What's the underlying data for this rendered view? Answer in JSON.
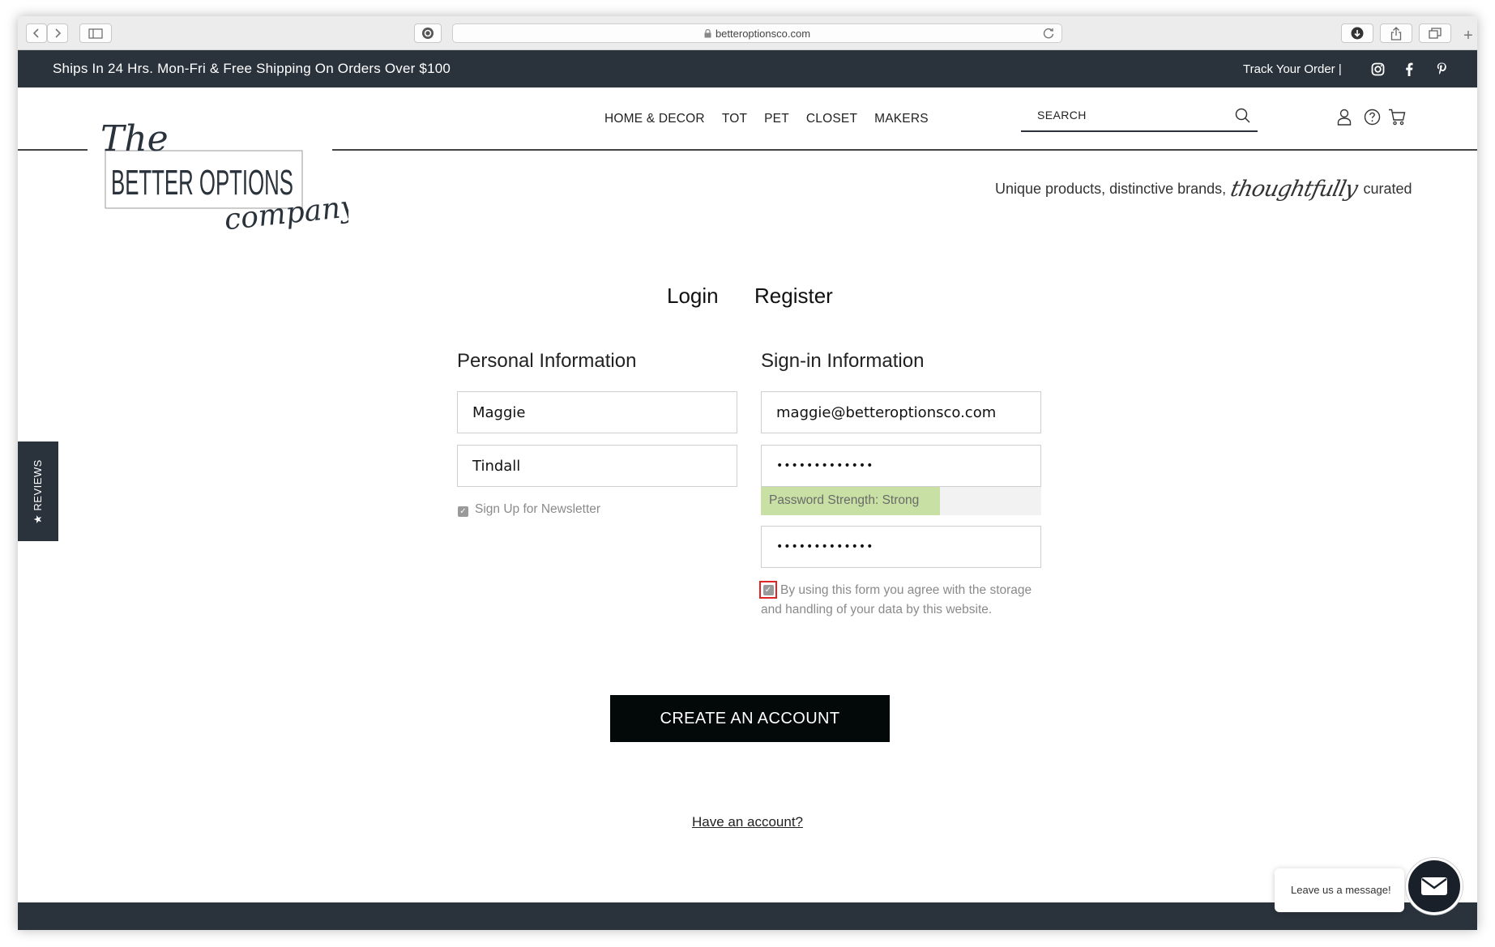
{
  "browser": {
    "url": "betteroptionsco.com"
  },
  "announcement": {
    "text": "Ships In 24 Hrs. Mon-Fri & Free Shipping On Orders Over $100",
    "track_order": "Track Your Order |"
  },
  "logo": {
    "the": "The",
    "main": "BETTER OPTIONS",
    "company": "company"
  },
  "nav": {
    "items": [
      "HOME & DECOR",
      "TOT",
      "PET",
      "CLOSET",
      "MAKERS"
    ]
  },
  "search": {
    "label": "SEARCH"
  },
  "tagline": {
    "prefix": "Unique products, distinctive brands,",
    "script": "thoughtfully",
    "suffix": "curated"
  },
  "reviews_tab": {
    "label": "★ REVIEWS"
  },
  "tabs": {
    "login": "Login",
    "register": "Register"
  },
  "personal": {
    "title": "Personal Information",
    "first_name": "Maggie",
    "last_name": "Tindall",
    "newsletter_label": "Sign Up for Newsletter",
    "newsletter_checked": true
  },
  "signin": {
    "title": "Sign-in Information",
    "email": "maggie@betteroptionsco.com",
    "password": "•••••••••••••",
    "password_strength": "Password Strength: Strong",
    "strength_level": 0.64,
    "confirm_password": "•••••••••••••",
    "agree_text": "By using this form you agree with the storage and handling of your data by this website.",
    "agree_checked": true
  },
  "actions": {
    "create_account": "CREATE AN ACCOUNT",
    "have_account": "Have an account?"
  },
  "chat": {
    "message": "Leave us a message!"
  },
  "colors": {
    "dark": "#2a323c",
    "button": "#030808",
    "strength_fill": "#c8e0a4",
    "highlight": "#e02424"
  }
}
